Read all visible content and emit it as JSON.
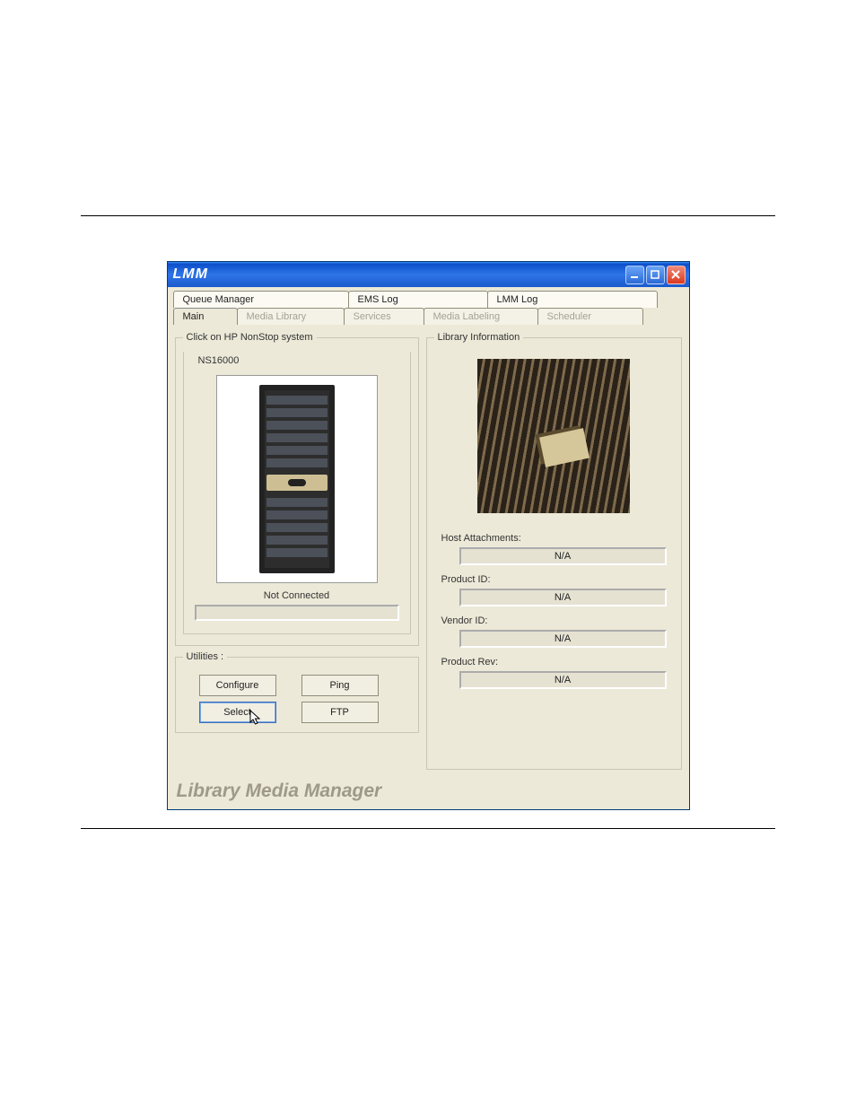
{
  "window": {
    "title": "LMM"
  },
  "tabs_row1": [
    {
      "label": "Queue Manager"
    },
    {
      "label": "EMS Log"
    },
    {
      "label": "LMM Log"
    }
  ],
  "tabs_row2": [
    {
      "label": "Main",
      "active": true
    },
    {
      "label": "Media Library"
    },
    {
      "label": "Services"
    },
    {
      "label": "Media Labeling"
    },
    {
      "label": "Scheduler"
    }
  ],
  "left": {
    "group_title": "Click on HP NonStop system",
    "system_label": "NS16000",
    "conn_status": "Not Connected",
    "utilities_title": "Utilities :",
    "buttons": {
      "configure": "Configure",
      "ping": "Ping",
      "select": "Select",
      "ftp": "FTP"
    }
  },
  "right": {
    "group_title": "Library Information",
    "fields": {
      "host_attachments_label": "Host Attachments:",
      "host_attachments_value": "N/A",
      "product_id_label": "Product ID:",
      "product_id_value": "N/A",
      "vendor_id_label": "Vendor ID:",
      "vendor_id_value": "N/A",
      "product_rev_label": "Product Rev:",
      "product_rev_value": "N/A"
    }
  },
  "footer": {
    "brand": "Library Media Manager"
  }
}
